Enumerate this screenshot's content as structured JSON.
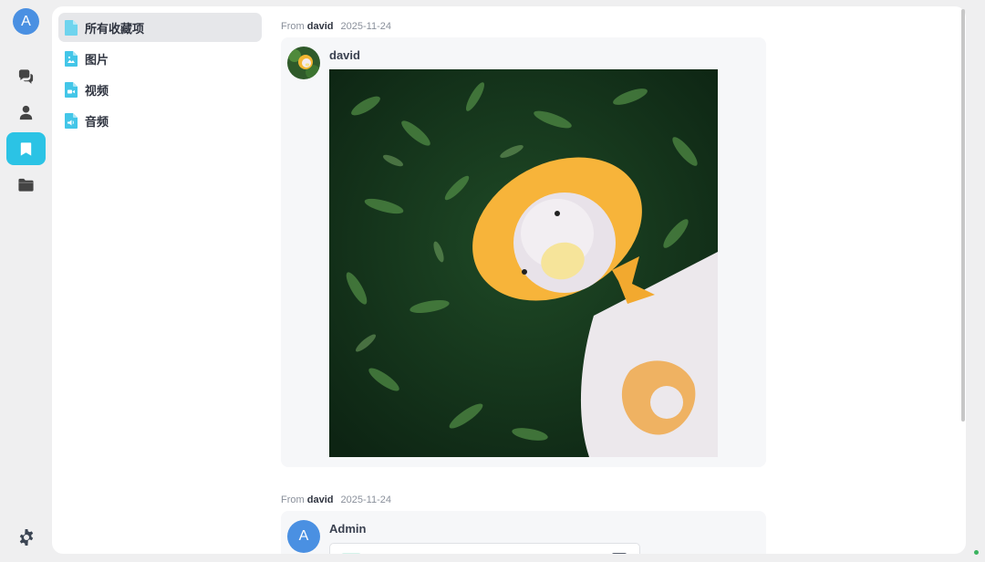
{
  "rail": {
    "avatar_letter": "A",
    "items": [
      {
        "icon": "chat-icon",
        "active": false
      },
      {
        "icon": "contacts-icon",
        "active": false
      },
      {
        "icon": "bookmark-icon",
        "active": true
      },
      {
        "icon": "folder-icon",
        "active": false
      }
    ],
    "settings_icon": "gear-icon"
  },
  "sidebar": {
    "items": [
      {
        "label": "所有收藏项",
        "icon": "file-icon",
        "active": true
      },
      {
        "label": "图片",
        "icon": "image-file-icon",
        "active": false
      },
      {
        "label": "视频",
        "icon": "video-file-icon",
        "active": false
      },
      {
        "label": "音频",
        "icon": "audio-file-icon",
        "active": false
      }
    ]
  },
  "feed": {
    "items": [
      {
        "from_label": "From",
        "from_user": "david",
        "date": "2025-11-24",
        "sender": "david"
      },
      {
        "from_label": "From",
        "from_user": "david",
        "date": "2025-11-24",
        "sender": "Admin",
        "sender_avatar_letter": "A"
      }
    ]
  },
  "colors": {
    "accent": "#2bc3e5",
    "avatar_blue": "#4a90e2"
  }
}
